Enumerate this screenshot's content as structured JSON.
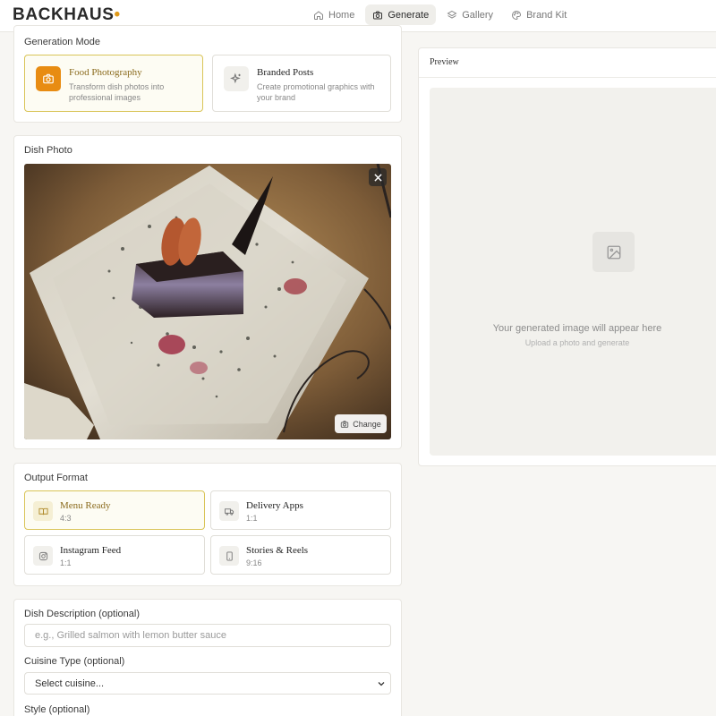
{
  "app": {
    "logo": "BACKHAUS",
    "logo_dot": "•",
    "accent": "#e09a1a"
  },
  "nav": [
    {
      "label": "Home",
      "icon": "home-icon",
      "active": false
    },
    {
      "label": "Generate",
      "icon": "camera-icon",
      "active": true
    },
    {
      "label": "Gallery",
      "icon": "layers-icon",
      "active": false
    },
    {
      "label": "Brand Kit",
      "icon": "palette-icon",
      "active": false
    }
  ],
  "generation_mode": {
    "label": "Generation Mode",
    "options": [
      {
        "title": "Food Photography",
        "description": "Transform dish photos into professional images",
        "icon": "camera-icon",
        "selected": true
      },
      {
        "title": "Branded Posts",
        "description": "Create promotional graphics with your brand",
        "icon": "sparkles-icon",
        "selected": false
      }
    ]
  },
  "dish_photo": {
    "label": "Dish Photo",
    "remove_icon": "close-icon",
    "change_label": "Change"
  },
  "output_format": {
    "label": "Output Format",
    "options": [
      {
        "title": "Menu Ready",
        "ratio": "4:3",
        "icon": "book-icon",
        "selected": true
      },
      {
        "title": "Delivery Apps",
        "ratio": "1:1",
        "icon": "truck-icon",
        "selected": false
      },
      {
        "title": "Instagram Feed",
        "ratio": "1:1",
        "icon": "instagram-icon",
        "selected": false
      },
      {
        "title": "Stories & Reels",
        "ratio": "9:16",
        "icon": "phone-icon",
        "selected": false
      }
    ]
  },
  "details": {
    "description_label": "Dish Description (optional)",
    "description_placeholder": "e.g., Grilled salmon with lemon butter sauce",
    "cuisine_label": "Cuisine Type (optional)",
    "cuisine_value": "Select cuisine...",
    "style_label": "Style (optional)"
  },
  "preview": {
    "title": "Preview",
    "empty_message": "Your generated image will appear here",
    "empty_hint": "Upload a photo and generate"
  }
}
